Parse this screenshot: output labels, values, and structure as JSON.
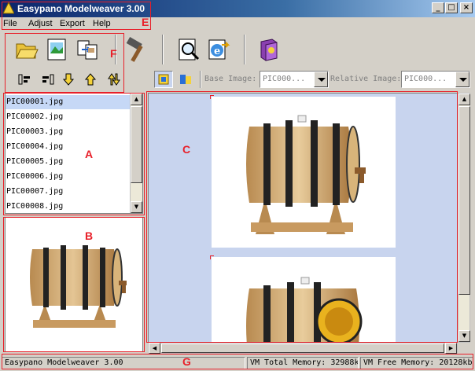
{
  "window": {
    "title": "Easypano Modelweaver 3.00"
  },
  "menu": {
    "items": [
      "File",
      "Adjust",
      "Export",
      "Help"
    ]
  },
  "callouts": {
    "a": "A",
    "b": "B",
    "c": "C",
    "e": "E",
    "f": "F",
    "g": "G"
  },
  "toolbar_large": [
    "open-folder-icon",
    "image-icon",
    "convert-icon",
    "hammer-icon",
    "magnifier-icon",
    "web-export-icon",
    "help-book-icon"
  ],
  "toolbar_small": [
    "align-left-icon",
    "align-right-icon",
    "move-down-icon",
    "move-up-icon",
    "swap-icon"
  ],
  "files": {
    "items": [
      "PIC00001.jpg",
      "PIC00002.jpg",
      "PIC00003.jpg",
      "PIC00004.jpg",
      "PIC00005.jpg",
      "PIC00006.jpg",
      "PIC00007.jpg",
      "PIC00008.jpg"
    ],
    "selected_index": 0
  },
  "viewbar": {
    "base_label": "Base Image:",
    "base_value": "PIC000...",
    "relative_label": "Relative Image:",
    "relative_value": "PIC000..."
  },
  "status": {
    "app": "Easypano Modelweaver 3.00",
    "total_memory": "VM Total Memory: 32988kb",
    "free_memory": "VM Free Memory: 20128kb"
  },
  "colors": {
    "callout": "#e8202a",
    "canvas_bg": "#c8d4ee",
    "selection": "#c6d8f6"
  }
}
